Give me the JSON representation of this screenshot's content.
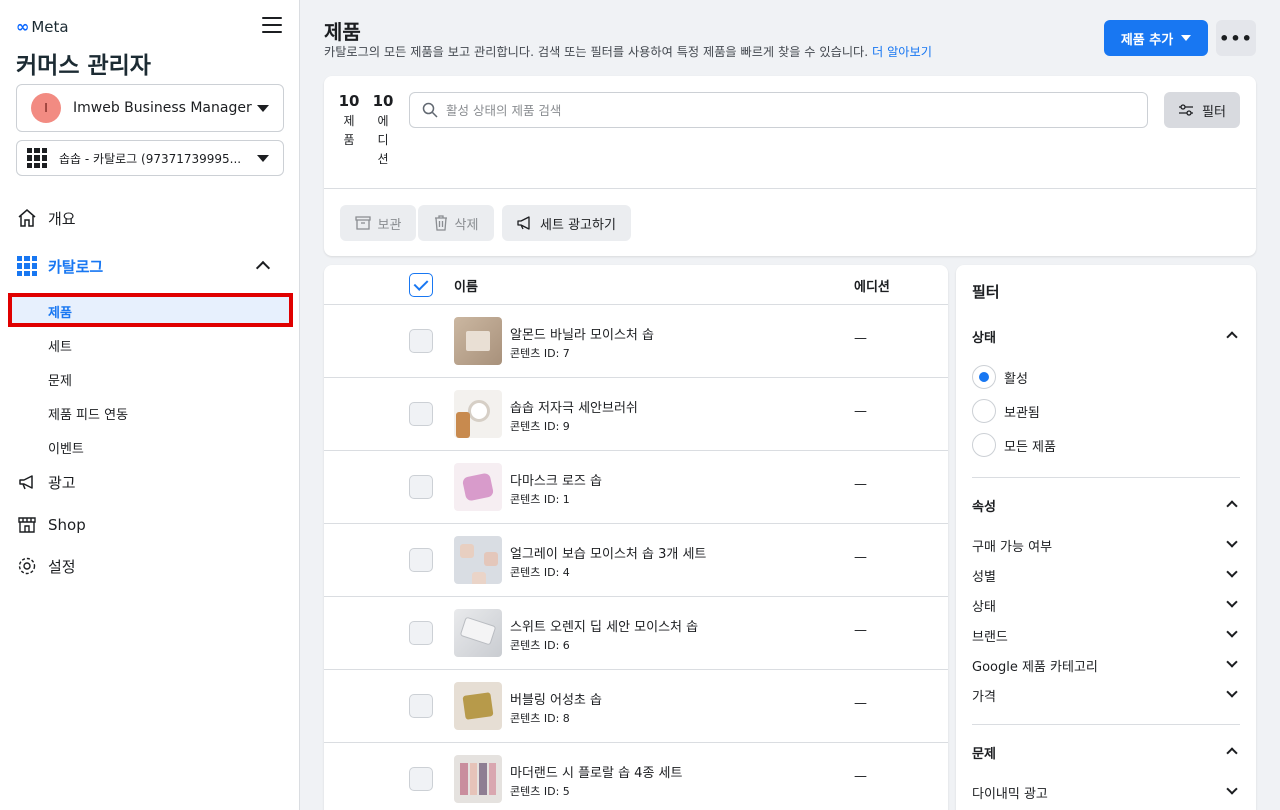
{
  "sidebar": {
    "brand": "Meta",
    "app_title": "커머스 관리자",
    "business": {
      "avatar_letter": "I",
      "name": "Imweb Business Manager"
    },
    "catalog": {
      "name": "솝솝 - 카탈로그 (97371739995..."
    },
    "nav": {
      "overview": "개요",
      "catalog": "카탈로그",
      "catalog_sub": {
        "products": "제품",
        "sets": "세트",
        "issues": "문제",
        "feeds": "제품 피드 연동",
        "events": "이벤트"
      },
      "ads": "광고",
      "shop": "Shop",
      "settings": "설정"
    }
  },
  "header": {
    "title": "제품",
    "description": "카탈로그의 모든 제품을 보고 관리합니다. 검색 또는 필터를 사용하여 특정 제품을 빠르게 찾을 수 있습니다.",
    "learn_more": "더 알아보기",
    "add_button": "제품 추가",
    "more_button": "•••"
  },
  "toolbar": {
    "stats": [
      {
        "num": "10",
        "label": [
          "제",
          "품"
        ]
      },
      {
        "num": "10",
        "label": [
          "에",
          "디",
          "션"
        ]
      }
    ],
    "search_placeholder": "활성 상태의 제품 검색",
    "filter_button": "필터",
    "archive_button": "보관",
    "delete_button": "삭제",
    "promote_button": "세트 광고하기"
  },
  "table": {
    "columns": {
      "name": "이름",
      "edition": "에디션"
    },
    "rows": [
      {
        "name": "알몬드 바닐라 모이스처 솝",
        "id": "콘텐츠 ID: 7",
        "edition": "—"
      },
      {
        "name": "솝솝 저자극 세안브러쉬",
        "id": "콘텐츠 ID: 9",
        "edition": "—"
      },
      {
        "name": "다마스크 로즈 솝",
        "id": "콘텐츠 ID: 1",
        "edition": "—"
      },
      {
        "name": "얼그레이 보습 모이스처 솝 3개 세트",
        "id": "콘텐츠 ID: 4",
        "edition": "—"
      },
      {
        "name": "스위트 오렌지 딥 세안 모이스처 솝",
        "id": "콘텐츠 ID: 6",
        "edition": "—"
      },
      {
        "name": "버블링 어성초 솝",
        "id": "콘텐츠 ID: 8",
        "edition": "—"
      },
      {
        "name": "마더랜드 시 플로랄 솝 4종 세트",
        "id": "콘텐츠 ID: 5",
        "edition": "—"
      }
    ]
  },
  "filters": {
    "title": "필터",
    "status": {
      "title": "상태",
      "options": [
        "활성",
        "보관됨",
        "모든 제품"
      ],
      "selected": "활성"
    },
    "attributes": {
      "title": "속성",
      "items": [
        "구매 가능 여부",
        "성별",
        "상태",
        "브랜드",
        "Google 제품 카테고리",
        "가격"
      ]
    },
    "issues": {
      "title": "문제",
      "items": [
        "다이내믹 광고"
      ]
    }
  },
  "colors": {
    "accent": "#1877f2",
    "highlight_border": "#e00000"
  }
}
